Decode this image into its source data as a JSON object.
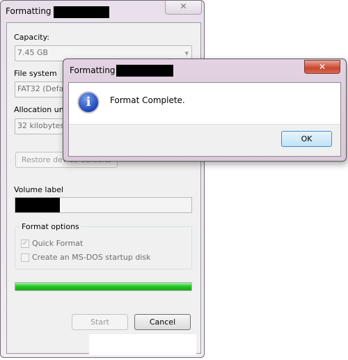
{
  "main_window": {
    "title": "Formatting",
    "close_icon": "close-icon",
    "capacity_label": "Capacity:",
    "capacity_value": "7.45 GB",
    "file_system_label": "File system",
    "file_system_value": "FAT32 (Default)",
    "allocation_label": "Allocation unit size",
    "allocation_value": "32 kilobytes",
    "restore_button": "Restore device defaults",
    "volume_label": "Volume label",
    "format_options": "Format options",
    "quick_format": "Quick Format",
    "quick_format_checked": true,
    "msdos": "Create an MS-DOS startup disk",
    "msdos_checked": false,
    "progress_percent": 100,
    "progress_color": "#22c422",
    "start_button": "Start",
    "cancel_button": "Cancel"
  },
  "dialog": {
    "title": "Formatting",
    "icon": "info-icon",
    "message": "Format Complete.",
    "ok_button": "OK"
  }
}
